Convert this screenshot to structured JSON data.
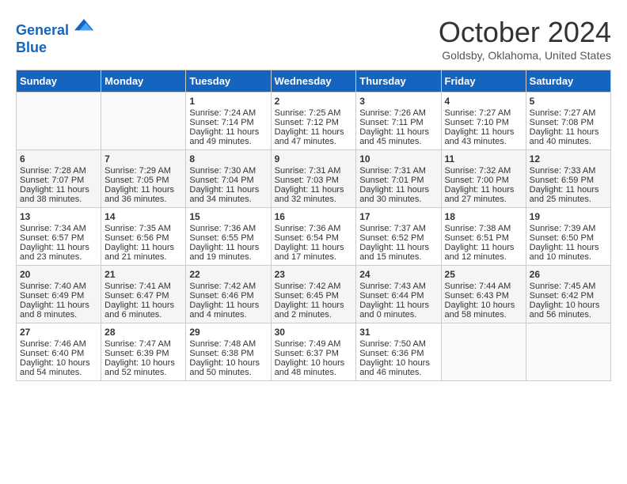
{
  "header": {
    "logo_line1": "General",
    "logo_line2": "Blue",
    "month": "October 2024",
    "location": "Goldsby, Oklahoma, United States"
  },
  "days_of_week": [
    "Sunday",
    "Monday",
    "Tuesday",
    "Wednesday",
    "Thursday",
    "Friday",
    "Saturday"
  ],
  "weeks": [
    [
      {
        "day": "",
        "sunrise": "",
        "sunset": "",
        "daylight": ""
      },
      {
        "day": "",
        "sunrise": "",
        "sunset": "",
        "daylight": ""
      },
      {
        "day": "1",
        "sunrise": "Sunrise: 7:24 AM",
        "sunset": "Sunset: 7:14 PM",
        "daylight": "Daylight: 11 hours and 49 minutes."
      },
      {
        "day": "2",
        "sunrise": "Sunrise: 7:25 AM",
        "sunset": "Sunset: 7:12 PM",
        "daylight": "Daylight: 11 hours and 47 minutes."
      },
      {
        "day": "3",
        "sunrise": "Sunrise: 7:26 AM",
        "sunset": "Sunset: 7:11 PM",
        "daylight": "Daylight: 11 hours and 45 minutes."
      },
      {
        "day": "4",
        "sunrise": "Sunrise: 7:27 AM",
        "sunset": "Sunset: 7:10 PM",
        "daylight": "Daylight: 11 hours and 43 minutes."
      },
      {
        "day": "5",
        "sunrise": "Sunrise: 7:27 AM",
        "sunset": "Sunset: 7:08 PM",
        "daylight": "Daylight: 11 hours and 40 minutes."
      }
    ],
    [
      {
        "day": "6",
        "sunrise": "Sunrise: 7:28 AM",
        "sunset": "Sunset: 7:07 PM",
        "daylight": "Daylight: 11 hours and 38 minutes."
      },
      {
        "day": "7",
        "sunrise": "Sunrise: 7:29 AM",
        "sunset": "Sunset: 7:05 PM",
        "daylight": "Daylight: 11 hours and 36 minutes."
      },
      {
        "day": "8",
        "sunrise": "Sunrise: 7:30 AM",
        "sunset": "Sunset: 7:04 PM",
        "daylight": "Daylight: 11 hours and 34 minutes."
      },
      {
        "day": "9",
        "sunrise": "Sunrise: 7:31 AM",
        "sunset": "Sunset: 7:03 PM",
        "daylight": "Daylight: 11 hours and 32 minutes."
      },
      {
        "day": "10",
        "sunrise": "Sunrise: 7:31 AM",
        "sunset": "Sunset: 7:01 PM",
        "daylight": "Daylight: 11 hours and 30 minutes."
      },
      {
        "day": "11",
        "sunrise": "Sunrise: 7:32 AM",
        "sunset": "Sunset: 7:00 PM",
        "daylight": "Daylight: 11 hours and 27 minutes."
      },
      {
        "day": "12",
        "sunrise": "Sunrise: 7:33 AM",
        "sunset": "Sunset: 6:59 PM",
        "daylight": "Daylight: 11 hours and 25 minutes."
      }
    ],
    [
      {
        "day": "13",
        "sunrise": "Sunrise: 7:34 AM",
        "sunset": "Sunset: 6:57 PM",
        "daylight": "Daylight: 11 hours and 23 minutes."
      },
      {
        "day": "14",
        "sunrise": "Sunrise: 7:35 AM",
        "sunset": "Sunset: 6:56 PM",
        "daylight": "Daylight: 11 hours and 21 minutes."
      },
      {
        "day": "15",
        "sunrise": "Sunrise: 7:36 AM",
        "sunset": "Sunset: 6:55 PM",
        "daylight": "Daylight: 11 hours and 19 minutes."
      },
      {
        "day": "16",
        "sunrise": "Sunrise: 7:36 AM",
        "sunset": "Sunset: 6:54 PM",
        "daylight": "Daylight: 11 hours and 17 minutes."
      },
      {
        "day": "17",
        "sunrise": "Sunrise: 7:37 AM",
        "sunset": "Sunset: 6:52 PM",
        "daylight": "Daylight: 11 hours and 15 minutes."
      },
      {
        "day": "18",
        "sunrise": "Sunrise: 7:38 AM",
        "sunset": "Sunset: 6:51 PM",
        "daylight": "Daylight: 11 hours and 12 minutes."
      },
      {
        "day": "19",
        "sunrise": "Sunrise: 7:39 AM",
        "sunset": "Sunset: 6:50 PM",
        "daylight": "Daylight: 11 hours and 10 minutes."
      }
    ],
    [
      {
        "day": "20",
        "sunrise": "Sunrise: 7:40 AM",
        "sunset": "Sunset: 6:49 PM",
        "daylight": "Daylight: 11 hours and 8 minutes."
      },
      {
        "day": "21",
        "sunrise": "Sunrise: 7:41 AM",
        "sunset": "Sunset: 6:47 PM",
        "daylight": "Daylight: 11 hours and 6 minutes."
      },
      {
        "day": "22",
        "sunrise": "Sunrise: 7:42 AM",
        "sunset": "Sunset: 6:46 PM",
        "daylight": "Daylight: 11 hours and 4 minutes."
      },
      {
        "day": "23",
        "sunrise": "Sunrise: 7:42 AM",
        "sunset": "Sunset: 6:45 PM",
        "daylight": "Daylight: 11 hours and 2 minutes."
      },
      {
        "day": "24",
        "sunrise": "Sunrise: 7:43 AM",
        "sunset": "Sunset: 6:44 PM",
        "daylight": "Daylight: 11 hours and 0 minutes."
      },
      {
        "day": "25",
        "sunrise": "Sunrise: 7:44 AM",
        "sunset": "Sunset: 6:43 PM",
        "daylight": "Daylight: 10 hours and 58 minutes."
      },
      {
        "day": "26",
        "sunrise": "Sunrise: 7:45 AM",
        "sunset": "Sunset: 6:42 PM",
        "daylight": "Daylight: 10 hours and 56 minutes."
      }
    ],
    [
      {
        "day": "27",
        "sunrise": "Sunrise: 7:46 AM",
        "sunset": "Sunset: 6:40 PM",
        "daylight": "Daylight: 10 hours and 54 minutes."
      },
      {
        "day": "28",
        "sunrise": "Sunrise: 7:47 AM",
        "sunset": "Sunset: 6:39 PM",
        "daylight": "Daylight: 10 hours and 52 minutes."
      },
      {
        "day": "29",
        "sunrise": "Sunrise: 7:48 AM",
        "sunset": "Sunset: 6:38 PM",
        "daylight": "Daylight: 10 hours and 50 minutes."
      },
      {
        "day": "30",
        "sunrise": "Sunrise: 7:49 AM",
        "sunset": "Sunset: 6:37 PM",
        "daylight": "Daylight: 10 hours and 48 minutes."
      },
      {
        "day": "31",
        "sunrise": "Sunrise: 7:50 AM",
        "sunset": "Sunset: 6:36 PM",
        "daylight": "Daylight: 10 hours and 46 minutes."
      },
      {
        "day": "",
        "sunrise": "",
        "sunset": "",
        "daylight": ""
      },
      {
        "day": "",
        "sunrise": "",
        "sunset": "",
        "daylight": ""
      }
    ]
  ]
}
